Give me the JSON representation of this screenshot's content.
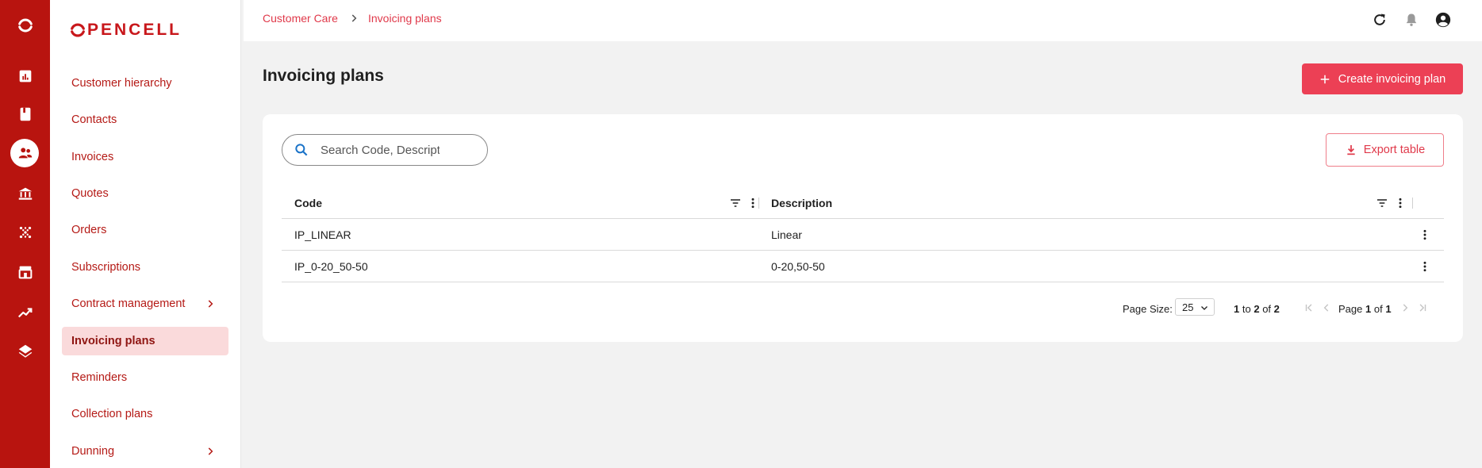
{
  "app": {
    "logo_text": "PENCELL",
    "brand_color": "#b8140f",
    "accent_color": "#ec4055"
  },
  "rail": {
    "icons": [
      "opencell-logo-icon",
      "dashboard-icon",
      "book-icon",
      "customers-icon",
      "bank-icon",
      "grid-dots-icon",
      "store-icon",
      "trending-up-icon",
      "layers-icon"
    ],
    "active": "customers-icon"
  },
  "sidebar": {
    "items": [
      {
        "label": "Customer hierarchy"
      },
      {
        "label": "Contacts"
      },
      {
        "label": "Invoices"
      },
      {
        "label": "Quotes"
      },
      {
        "label": "Orders"
      },
      {
        "label": "Subscriptions"
      },
      {
        "label": "Contract management",
        "expandable": true
      },
      {
        "label": "Invoicing plans",
        "active": true
      },
      {
        "label": "Reminders"
      },
      {
        "label": "Collection plans"
      },
      {
        "label": "Dunning",
        "expandable": true
      }
    ]
  },
  "breadcrumb": {
    "parent": "Customer Care",
    "current": "Invoicing plans"
  },
  "topbar": {
    "icons": [
      "refresh-icon",
      "bell-icon",
      "account-icon"
    ]
  },
  "page": {
    "title": "Invoicing plans",
    "create_label": "Create invoicing plan"
  },
  "search": {
    "placeholder": "Search Code, Description",
    "value": ""
  },
  "export": {
    "label": "Export table"
  },
  "table": {
    "columns": [
      "Code",
      "Description"
    ],
    "rows": [
      {
        "code": "IP_LINEAR",
        "description": "Linear"
      },
      {
        "code": "IP_0-20_50-50",
        "description": "0-20,50-50"
      }
    ]
  },
  "pagination": {
    "page_size_label": "Page Size:",
    "page_size": "25",
    "range_from": "1",
    "range_to_word": "to",
    "range_to": "2",
    "of_word": "of",
    "total": "2",
    "page_word": "Page",
    "page": "1",
    "page_of_word": "of",
    "page_total": "1"
  }
}
